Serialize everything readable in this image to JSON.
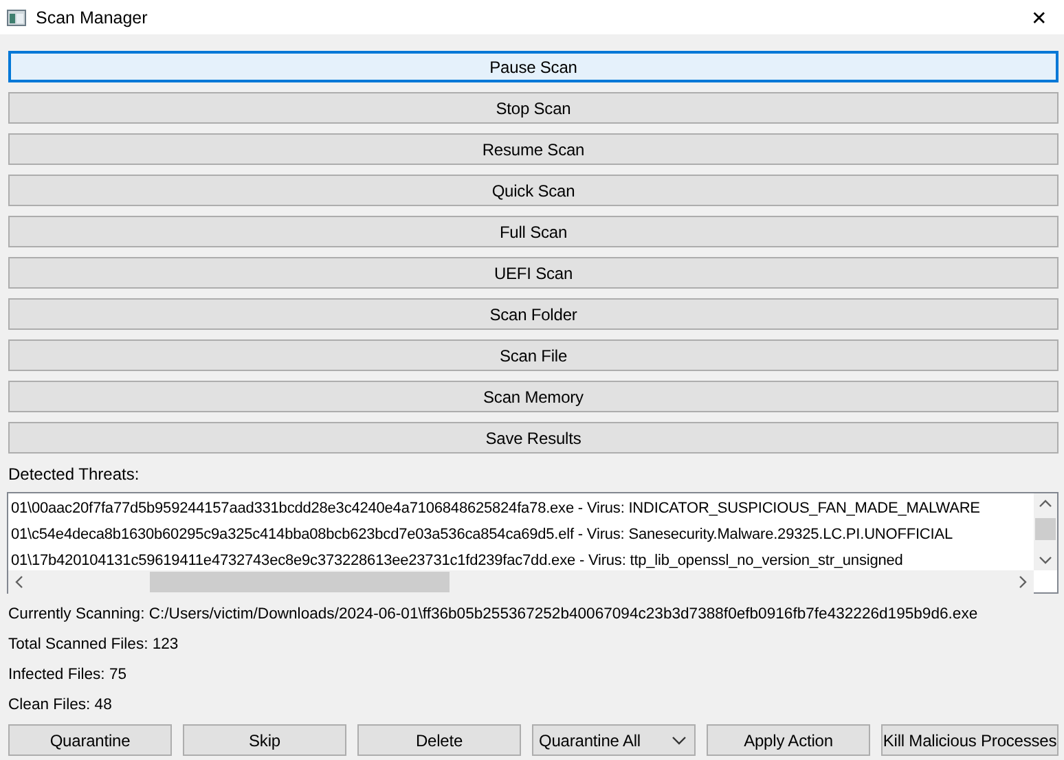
{
  "window": {
    "title": "Scan Manager",
    "close": "✕"
  },
  "scan_buttons": [
    {
      "label": "Pause Scan",
      "focused": true
    },
    {
      "label": "Stop Scan",
      "focused": false
    },
    {
      "label": "Resume Scan",
      "focused": false
    },
    {
      "label": "Quick Scan",
      "focused": false
    },
    {
      "label": "Full Scan",
      "focused": false
    },
    {
      "label": "UEFI Scan",
      "focused": false
    },
    {
      "label": "Scan Folder",
      "focused": false
    },
    {
      "label": "Scan File",
      "focused": false
    },
    {
      "label": "Scan Memory",
      "focused": false
    },
    {
      "label": "Save Results",
      "focused": false
    }
  ],
  "threats_label": "Detected Threats:",
  "threats": [
    "01\\00aac20f7fa77d5b959244157aad331bcdd28e3c4240e4a7106848625824fa78.exe - Virus: INDICATOR_SUSPICIOUS_FAN_MADE_MALWARE",
    "01\\c54e4deca8b1630b60295c9a325c414bba08bcb623bcd7e03a536ca854ca69d5.elf - Virus: Sanesecurity.Malware.29325.LC.PI.UNOFFICIAL",
    "01\\17b420104131c59619411e4732743ec8e9c373228613ee23731c1fd239fac7dd.exe - Virus: ttp_lib_openssl_no_version_str_unsigned"
  ],
  "status": [
    "Currently Scanning: C:/Users/victim/Downloads/2024-06-01\\ff36b05b255367252b40067094c23b3d7388f0efb0916fb7fe432226d195b9d6.exe",
    "Total Scanned Files: 123",
    "Infected Files: 75",
    "Clean Files: 48"
  ],
  "actions": [
    {
      "kind": "button",
      "label": "Quarantine"
    },
    {
      "kind": "button",
      "label": "Skip"
    },
    {
      "kind": "button",
      "label": "Delete"
    },
    {
      "kind": "dropdown",
      "label": "Quarantine All"
    },
    {
      "kind": "button",
      "label": "Apply Action"
    },
    {
      "kind": "button",
      "label": "Kill Malicious Processes"
    }
  ]
}
